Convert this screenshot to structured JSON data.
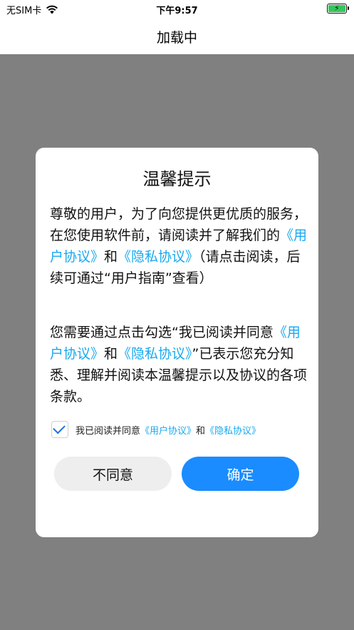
{
  "status_bar": {
    "carrier": "无SIM卡",
    "time": "下午9:57",
    "wifi_icon": "wifi-icon",
    "battery_icon": "battery-charging-icon"
  },
  "nav": {
    "title": "加载中"
  },
  "dialog": {
    "title": "温馨提示",
    "para1": {
      "t1": "尊敬的用户，为了向您提供更优质的服务，在您使用软件前，请阅读并了解我们的",
      "link1": "《用户协议》",
      "t2": "和",
      "link2": "《隐私协议》",
      "t3": "（请点击阅读，后续可通过“用户指南”查看）"
    },
    "para2": {
      "t1": "您需要通过点击勾选“我已阅读并同意",
      "link1": "《用户协议》",
      "t2": "和",
      "link2": "《隐私协议》",
      "t3": "”已表示您充分知悉、理解并阅读本温馨提示以及协议的各项条款。"
    },
    "agree": {
      "checked": true,
      "t1": "我已阅读并同意",
      "link1": "《用户协议》",
      "t2": "和",
      "link2": "《隐私协议》"
    },
    "buttons": {
      "disagree": "不同意",
      "ok": "确定"
    }
  },
  "colors": {
    "link": "#17a9f0",
    "primary": "#1a8cff",
    "overlay": "#808080",
    "battery": "#34c759"
  }
}
